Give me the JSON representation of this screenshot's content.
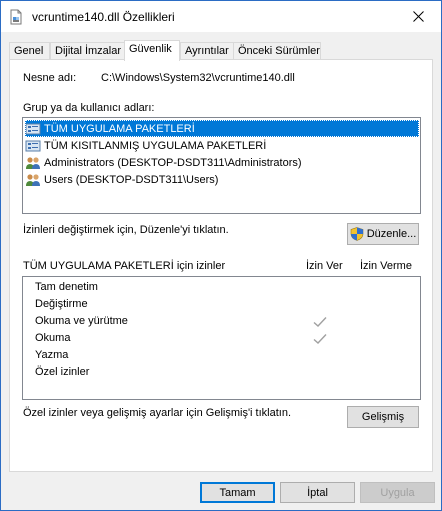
{
  "window": {
    "title": "vcruntime140.dll Özellikleri"
  },
  "tabs": [
    {
      "label": "Genel"
    },
    {
      "label": "Dijital İmzalar"
    },
    {
      "label": "Güvenlik"
    },
    {
      "label": "Ayrıntılar"
    },
    {
      "label": "Önceki Sürümler"
    }
  ],
  "security": {
    "object_label": "Nesne adı:",
    "object_value": "C:\\Windows\\System32\\vcruntime140.dll",
    "groups_label": "Grup ya da kullanıcı adları:",
    "groups": [
      {
        "name": "TÜM UYGULAMA PAKETLERİ",
        "icon": "package-group-icon",
        "selected": true
      },
      {
        "name": "TÜM KISITLANMIŞ UYGULAMA PAKETLERİ",
        "icon": "package-group-icon",
        "selected": false
      },
      {
        "name": "Administrators (DESKTOP-DSDT311\\Administrators)",
        "icon": "users-group-icon",
        "selected": false
      },
      {
        "name": "Users (DESKTOP-DSDT311\\Users)",
        "icon": "users-group-icon",
        "selected": false
      }
    ],
    "edit_hint": "İzinleri değiştirmek için, Düzenle'yi tıklatın.",
    "edit_button": "Düzenle...",
    "permissions_title": "TÜM UYGULAMA PAKETLERİ için izinler",
    "allow_header": "İzin Ver",
    "deny_header": "İzin Verme",
    "permissions": [
      {
        "name": "Tam denetim",
        "allow": false,
        "deny": false
      },
      {
        "name": "Değiştirme",
        "allow": false,
        "deny": false
      },
      {
        "name": "Okuma ve yürütme",
        "allow": true,
        "deny": false
      },
      {
        "name": "Okuma",
        "allow": true,
        "deny": false
      },
      {
        "name": "Yazma",
        "allow": false,
        "deny": false
      },
      {
        "name": "Özel izinler",
        "allow": false,
        "deny": false
      }
    ],
    "advanced_hint": "Özel izinler veya gelişmiş ayarlar için Gelişmiş'i tıklatın.",
    "advanced_button": "Gelişmiş"
  },
  "footer": {
    "ok": "Tamam",
    "cancel": "İptal",
    "apply": "Uygula"
  },
  "colors": {
    "selection": "#0078d7",
    "check_disabled": "#a0a0a0"
  }
}
